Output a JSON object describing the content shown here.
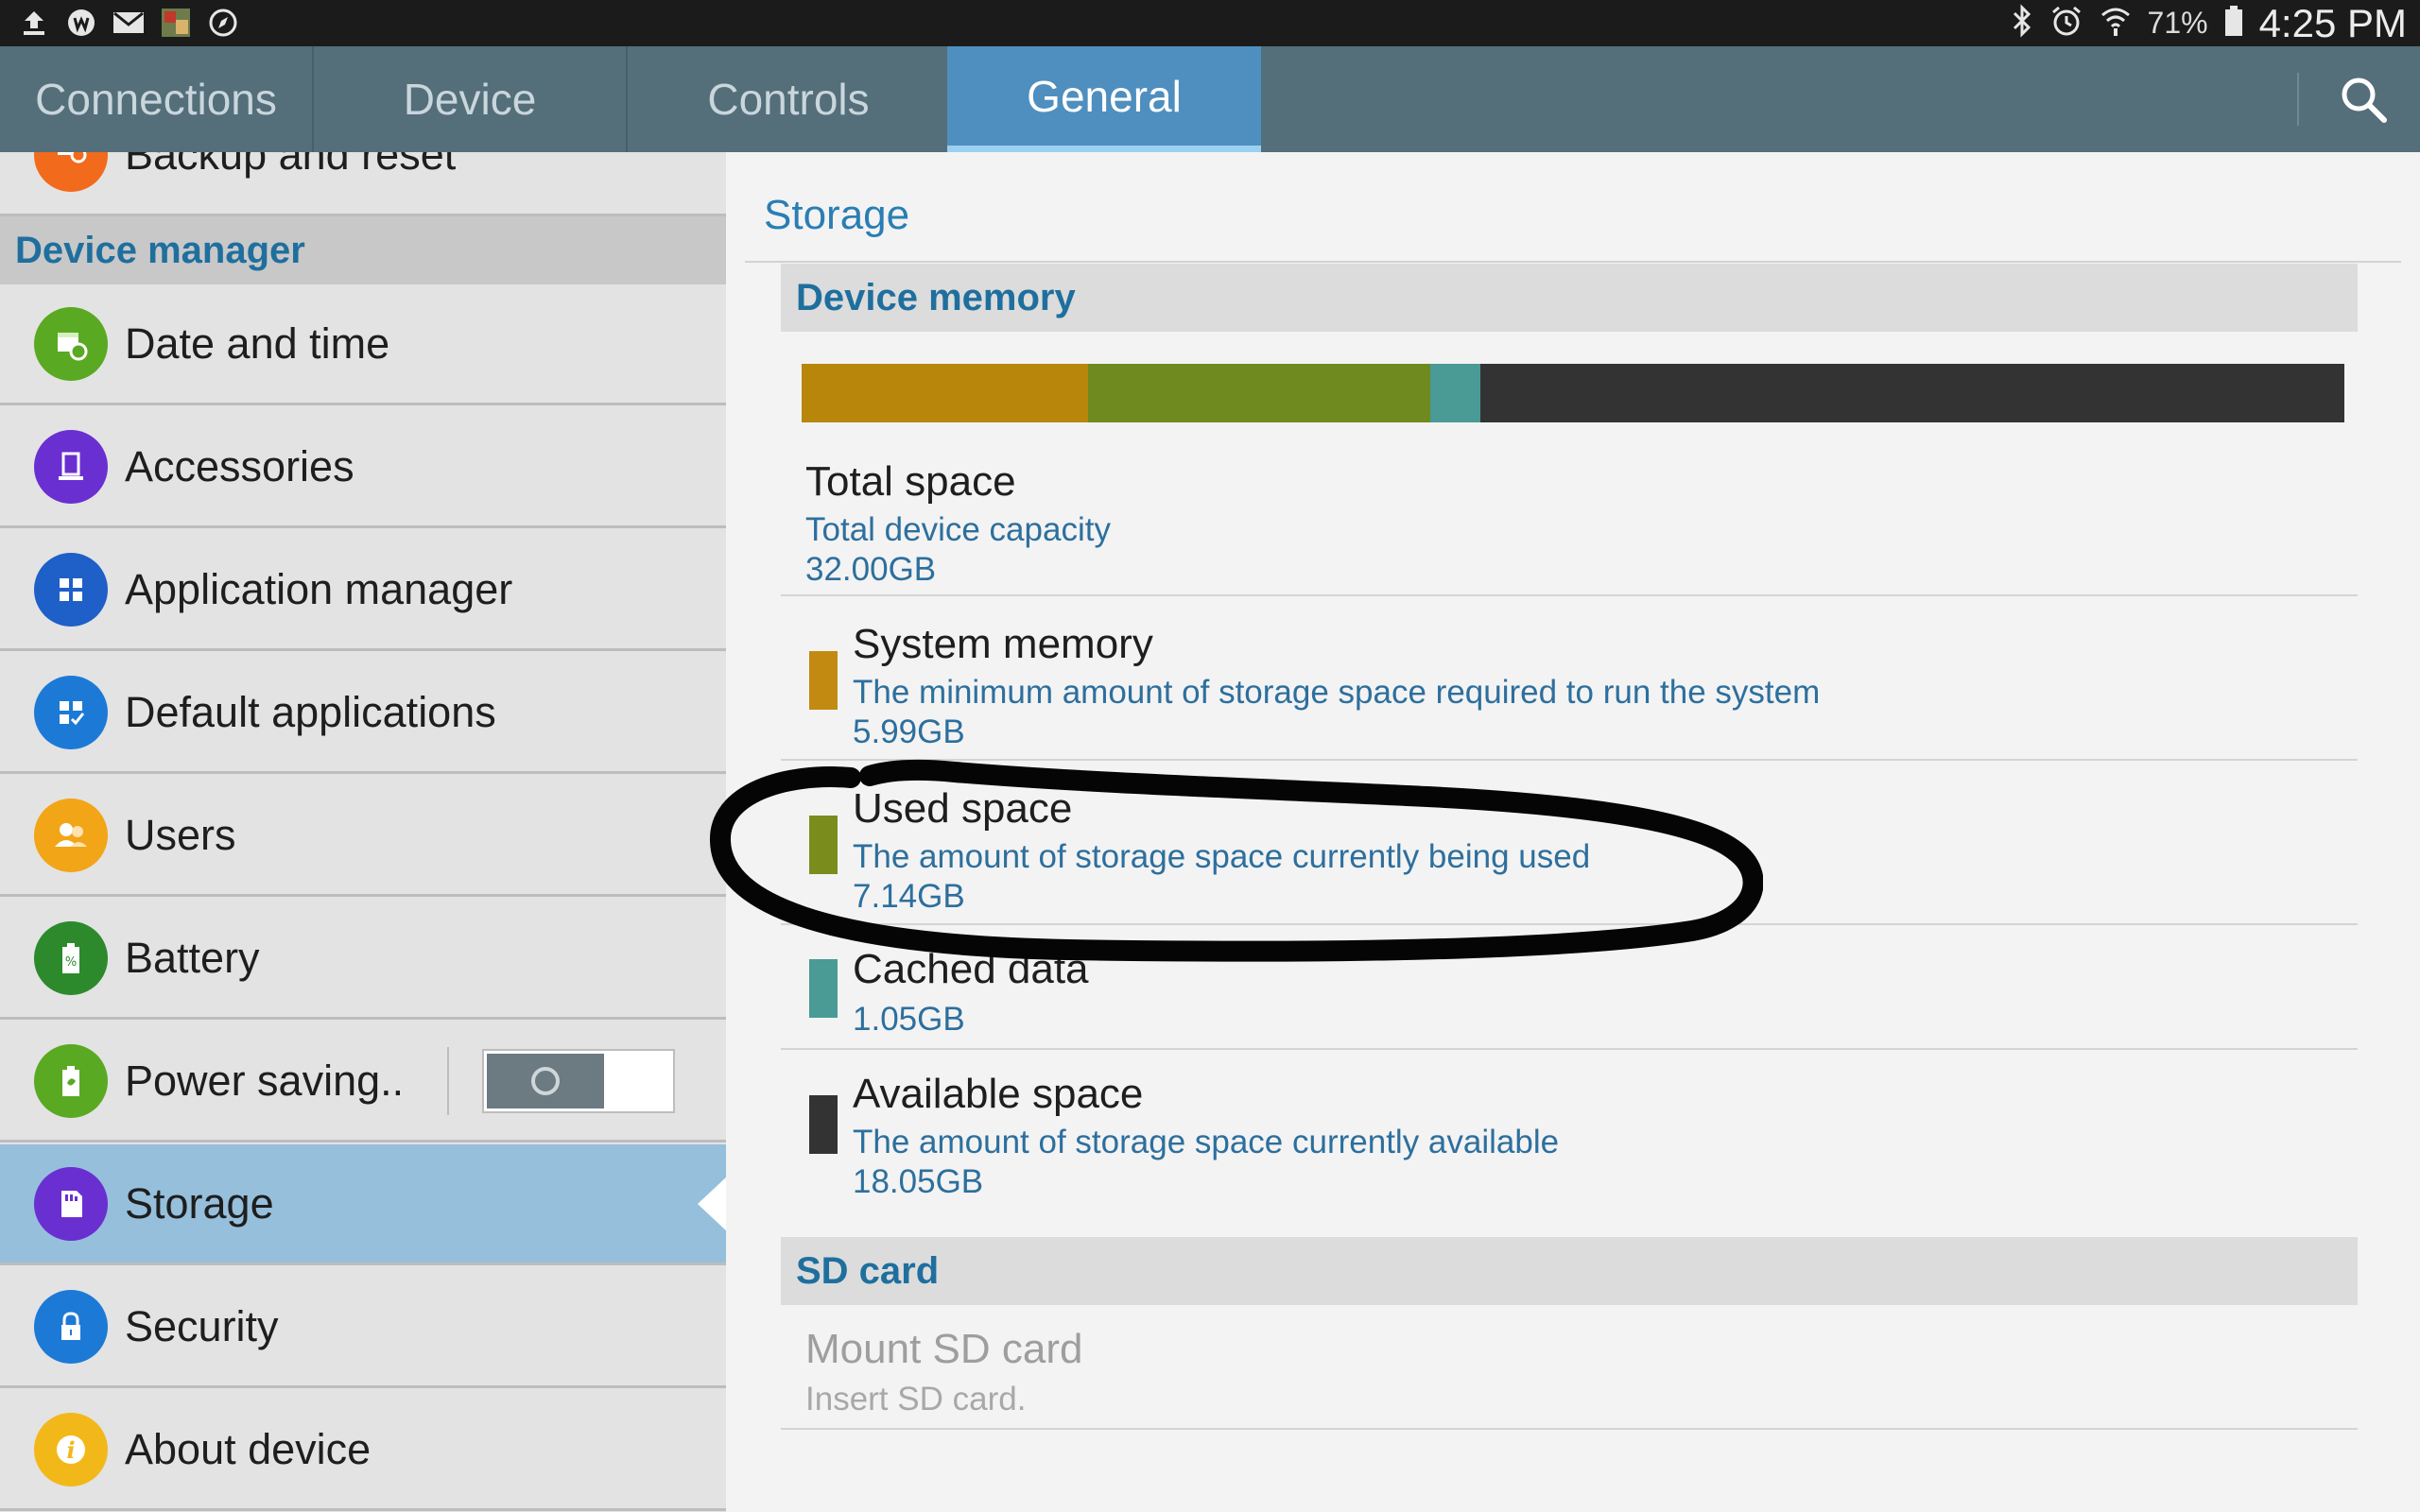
{
  "status_bar": {
    "battery_percent": "71%",
    "time": "4:25 PM",
    "left_icons": [
      "upload-icon",
      "whatsapp-icon",
      "gmail-icon",
      "photo-icon",
      "compass-icon"
    ],
    "right_icons": [
      "bluetooth-icon",
      "alarm-icon",
      "wifi-icon",
      "battery-icon"
    ]
  },
  "tabs": [
    {
      "label": "Connections",
      "active": false
    },
    {
      "label": "Device",
      "active": false
    },
    {
      "label": "Controls",
      "active": false
    },
    {
      "label": "General",
      "active": true
    }
  ],
  "sidebar": {
    "partial_item": {
      "label": "Backup and reset",
      "icon": "backup-icon"
    },
    "section_header": "Device manager",
    "items": [
      {
        "label": "Date and time",
        "icon": "calendar-clock-icon",
        "color": "#5aa922"
      },
      {
        "label": "Accessories",
        "icon": "accessory-icon",
        "color": "#6a2fd0"
      },
      {
        "label": "Application manager",
        "icon": "grid-icon",
        "color": "#1e5fc8"
      },
      {
        "label": "Default applications",
        "icon": "grid-check-icon",
        "color": "#1c7ad6"
      },
      {
        "label": "Users",
        "icon": "users-icon",
        "color": "#f2a516"
      },
      {
        "label": "Battery",
        "icon": "battery-icon",
        "color": "#2c8a2c"
      },
      {
        "label": "Power saving..",
        "icon": "power-saving-icon",
        "color": "#5aa922"
      },
      {
        "label": "Storage",
        "icon": "sd-storage-icon",
        "color": "#6a2fd0",
        "selected": true
      },
      {
        "label": "Security",
        "icon": "lock-icon",
        "color": "#1c7ad6"
      },
      {
        "label": "About device",
        "icon": "info-icon",
        "color": "#f2b81a"
      }
    ],
    "power_saving_toggle": "off"
  },
  "main": {
    "title": "Storage",
    "device_memory_header": "Device memory",
    "memory_bar": [
      {
        "name": "System memory",
        "gb": 5.99,
        "color": "#b8860b"
      },
      {
        "name": "Used space",
        "gb": 7.14,
        "color": "#6f8a1e"
      },
      {
        "name": "Cached data",
        "gb": 1.05,
        "color": "#4a9a96"
      },
      {
        "name": "Available space",
        "gb": 18.05,
        "color": "#333333"
      }
    ],
    "total": {
      "title": "Total space",
      "subtitle": "Total device capacity",
      "value": "32.00GB"
    },
    "system": {
      "title": "System memory",
      "subtitle": "The minimum amount of storage space required to run the system",
      "value": "5.99GB",
      "color": "#c28a10"
    },
    "used": {
      "title": "Used space",
      "subtitle": "The amount of storage space currently being used",
      "value": "7.14GB",
      "color": "#7a8c1c"
    },
    "cached": {
      "title": "Cached data",
      "value": "1.05GB",
      "color": "#4a9a96"
    },
    "available": {
      "title": "Available space",
      "subtitle": "The amount of storage space currently available",
      "value": "18.05GB",
      "color": "#333333"
    },
    "sd_card_header": "SD card",
    "mount": {
      "title": "Mount SD card",
      "subtitle": "Insert SD card."
    }
  }
}
